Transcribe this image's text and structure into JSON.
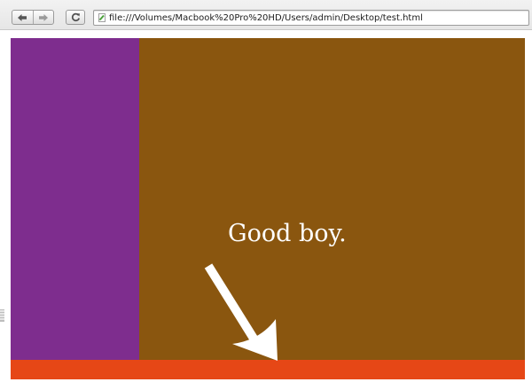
{
  "browser": {
    "url": "file:///Volumes/Macbook%20Pro%20HD/Users/admin/Desktop/test.html",
    "back_icon": "arrow-left-icon",
    "forward_icon": "arrow-right-icon",
    "reload_icon": "reload-icon",
    "page_icon": "page-icon"
  },
  "page": {
    "message": "Good boy.",
    "colors": {
      "sidebar": "#7e2d8e",
      "content": "#8a560f",
      "footer": "#e64716",
      "text": "#ffffff",
      "arrow": "#ffffff"
    }
  }
}
